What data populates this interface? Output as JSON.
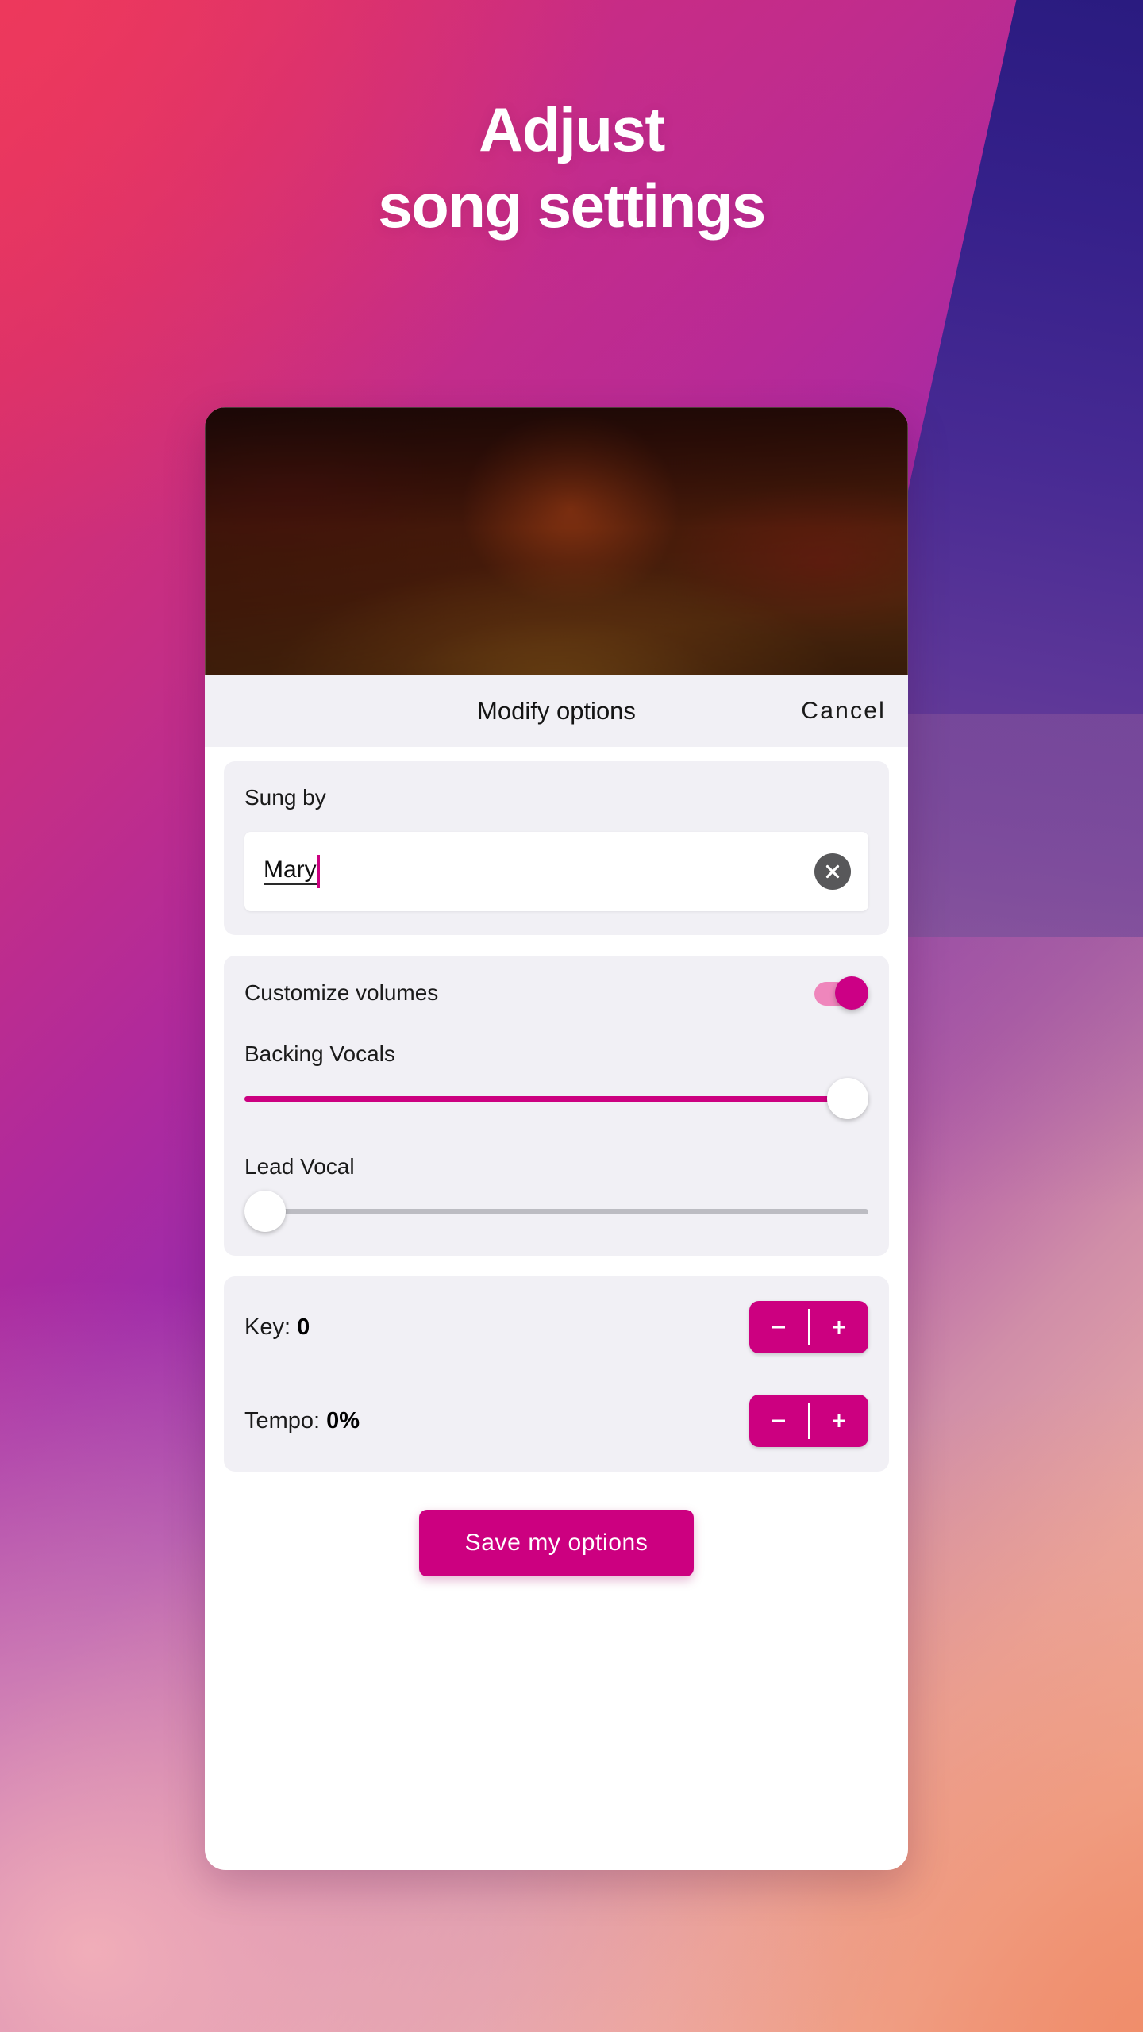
{
  "headline": {
    "line1": "Adjust",
    "line2": "song settings"
  },
  "sheet": {
    "title": "Modify options",
    "cancel_label": "Cancel",
    "hero_image_name": "blurred-song-artwork"
  },
  "singer": {
    "label": "Sung by",
    "value": "Mary",
    "placeholder": "Sung by",
    "clear_icon": "close-circle-icon"
  },
  "volumes": {
    "label": "Customize volumes",
    "toggle_state": "on",
    "sliders": [
      {
        "label": "Backing Vocals",
        "value": 100
      },
      {
        "label": "Lead Vocal",
        "value": 0
      }
    ]
  },
  "tuning": {
    "rows": [
      {
        "label": "Key:",
        "value": "0",
        "minus_icon": "minus-icon",
        "plus_icon": "plus-icon"
      },
      {
        "label": "Tempo:",
        "value": "0%",
        "minus_icon": "minus-icon",
        "plus_icon": "plus-icon"
      }
    ]
  },
  "save": {
    "label": "Save my options"
  },
  "colors": {
    "accent": "#cc0080",
    "toggle_track": "#ef86bc",
    "panel_bg": "#f1f0f5",
    "slider_track": "#bcbcc2",
    "clear_icon_bg": "#58585a"
  }
}
